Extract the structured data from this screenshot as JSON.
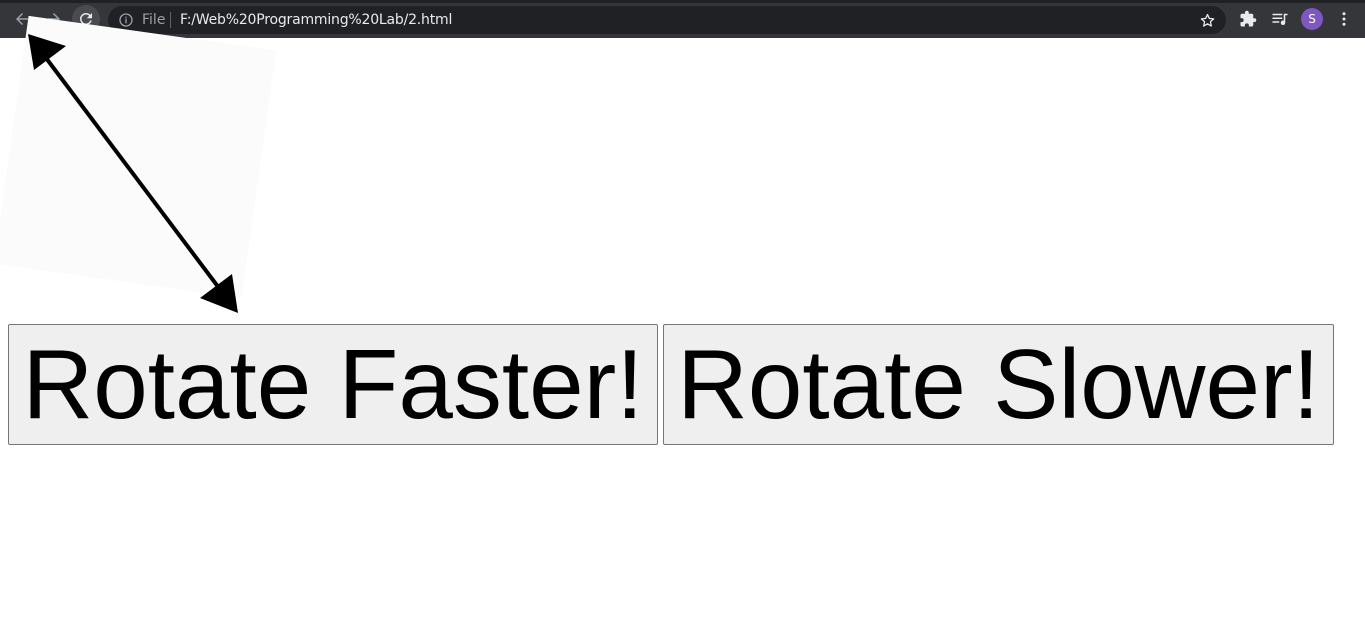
{
  "browser": {
    "scheme_label": "File",
    "url": "F:/Web%20Programming%20Lab/2.html",
    "profile_initial": "S",
    "icons": [
      "back-icon",
      "forward-icon",
      "reload-icon",
      "info-icon",
      "star-icon",
      "extensions-icon",
      "media-icon",
      "menu-icon"
    ]
  },
  "page": {
    "faster_button_label": "Rotate Faster!",
    "slower_button_label": "Rotate Slower!"
  },
  "colors": {
    "chrome_bg": "#35363a",
    "omnibox_bg": "#202124",
    "avatar": "#7e57c2",
    "button_bg": "#efefef"
  }
}
